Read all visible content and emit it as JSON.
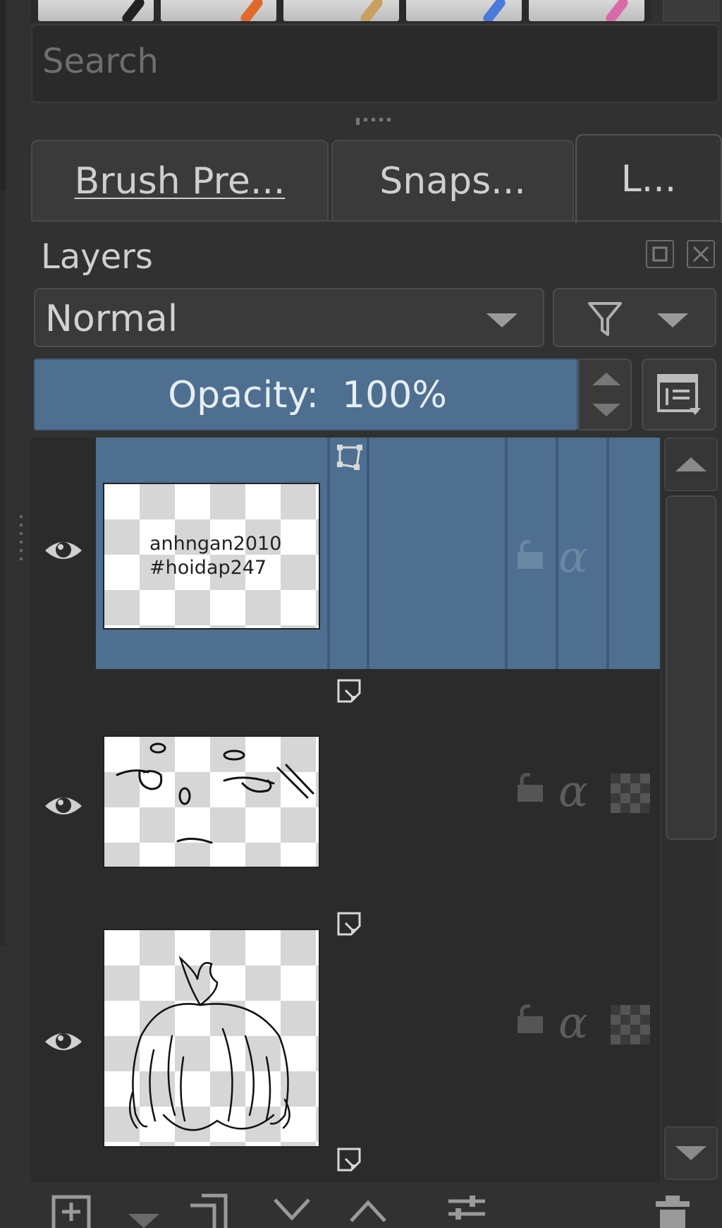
{
  "search": {
    "placeholder": "Search"
  },
  "tabs": [
    {
      "label": "Brush Pre...",
      "active": false
    },
    {
      "label": "Snaps...",
      "active": false
    },
    {
      "label": "L...",
      "active": true
    }
  ],
  "layers_panel": {
    "title": "Layers",
    "blend_mode": "Normal",
    "opacity": {
      "label": "Opacity:",
      "value": "100%"
    }
  },
  "layers": [
    {
      "thumb_text_1": "anhngan2010",
      "thumb_text_2": "#hoidap247",
      "selected": true,
      "visible": true
    },
    {
      "selected": false,
      "visible": true
    },
    {
      "selected": false,
      "visible": true
    }
  ],
  "icons": {
    "eye": "eye-icon",
    "lock": "lock-icon",
    "alpha": "α",
    "float": "float-icon",
    "close": "close-icon",
    "filter": "filter-icon"
  },
  "colors": {
    "selection": "#4e6f90",
    "panel": "#313131",
    "list_bg": "#2b2b2b"
  }
}
